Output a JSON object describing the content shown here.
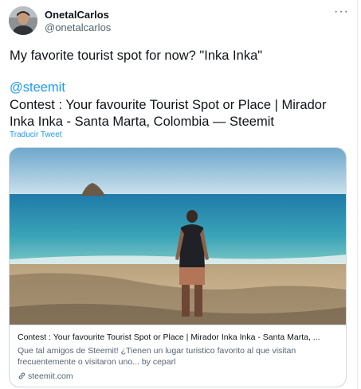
{
  "author": {
    "name": "OnetalCarlos",
    "handle": "@onetalcarlos"
  },
  "more_label": "···",
  "tweet": {
    "line1": "My favorite tourist spot for now? \"Inka Inka\"",
    "mention": "@steemit",
    "line3": "Contest : Your favourite Tourist Spot or Place | Mirador Inka Inka - Santa Marta, Colombia — Steemit",
    "translate_label": "Traducir Tweet"
  },
  "card": {
    "title": "Contest : Your favourite Tourist Spot or Place | Mirador Inka Inka - Santa Marta, ...",
    "description": "Que tal amigos de Steemit! ¿Tienen un lugar turistico favorito al que visitan frecuentemente o visitaron uno... by ceparl",
    "domain": "steemit.com",
    "domain_icon": "link-icon"
  },
  "colors": {
    "link": "#1d9bf0",
    "text": "#0f1419",
    "secondary": "#536471",
    "border": "#cfd9de"
  }
}
